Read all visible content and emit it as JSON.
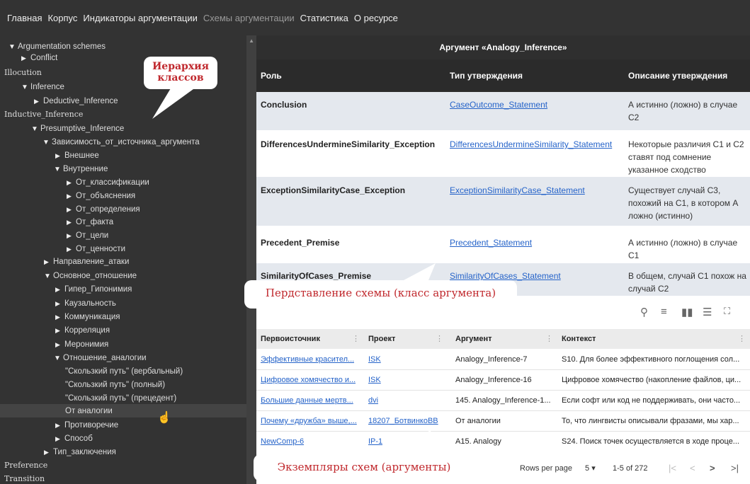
{
  "nav": {
    "items": [
      "Главная",
      "Корпус",
      "Индикаторы аргументации",
      "Схемы аргументации",
      "Статистика",
      "О ресурсе"
    ],
    "active": "Схемы аргументации"
  },
  "tree": {
    "root": "Argumentation schemes",
    "conflict": "Conflict",
    "illocution": "Illocution",
    "inference": "Inference",
    "deductive": "Deductive_Inference",
    "inductive": "Inductive_Inference",
    "presumptive": "Presumptive_Inference",
    "source_dep": "Зависимость_от_источника_аргумента",
    "external": "Внешнее",
    "internal": "Внутренние",
    "from_classification": "От_классификации",
    "from_explanation": "От_объяснения",
    "from_definition": "От_определения",
    "from_fact": "От_факта",
    "from_goal": "От_цели",
    "from_value": "От_ценности",
    "attack_direction": "Направление_атаки",
    "main_relation": "Основное_отношение",
    "hyper_hyponymy": "Гипер_Гипонимия",
    "causality": "Каузальность",
    "communication": "Коммуникация",
    "correlation": "Корреляция",
    "meronymy": "Меронимия",
    "analogy_relation": "Отношение_аналогии",
    "slippery_verbal": "\"Скользкий путь\" (вербальный)",
    "slippery_full": "\"Скользкий путь\" (полный)",
    "slippery_precedent": "\"Скользкий путь\" (прецедент)",
    "from_analogy": "От аналогии",
    "contradiction": "Противоречие",
    "method": "Способ",
    "conclusion_type": "Тип_заключения",
    "preference": "Preference",
    "transition": "Transition"
  },
  "callouts": {
    "hierarchy": "Иерархия классов",
    "scheme": "Пердставление схемы (класс аргумента)",
    "instances": "Экземпляры схем (аргументы)"
  },
  "argument": {
    "title": "Аргумент «Analogy_Inference»",
    "columns": [
      "Роль",
      "Тип утверждения",
      "Описание утверждения"
    ],
    "rows": [
      {
        "role": "Conclusion",
        "type": "CaseOutcome_Statement",
        "desc": "А истинно (ложно) в случае С2"
      },
      {
        "role": "DifferencesUndermineSimilarity_Exception",
        "type": "DifferencesUndermineSimilarity_Statement",
        "desc": "Некоторые различия С1 и С2 ставят под сомнение указанное сходство"
      },
      {
        "role": "ExceptionSimilarityCase_Exception",
        "type": "ExceptionSimilarityCase_Statement",
        "desc": "Существует случай С3, похожий на С1, в котором А ложно (истинно)"
      },
      {
        "role": "Precedent_Premise",
        "type": "Precedent_Statement",
        "desc": "А истинно (ложно) в случае С1"
      },
      {
        "role": "SimilarityOfCases_Premise",
        "type": "SimilarityOfCases_Statement",
        "desc": "В общем, случай С1 похож на случай С2"
      }
    ]
  },
  "instances": {
    "columns": [
      "Первоисточник",
      "Проект",
      "Аргумент",
      "Контекст"
    ],
    "rows": [
      {
        "source": "Эффективные красител...",
        "project": "ISK",
        "argument": "Analogy_Inference-7",
        "context": "S10. Для более эффективного поглощения сол..."
      },
      {
        "source": "Цифровое хомячество и...",
        "project": "ISK",
        "argument": "Analogy_Inference-16",
        "context": "Цифровое хомячество (накопление файлов, ци..."
      },
      {
        "source": "Большие данные мертв...",
        "project": "dvi",
        "argument": "145. Analogy_Inference-1...",
        "context": "Если софт или код не поддерживать, они часто..."
      },
      {
        "source": "Почему «дружба» выше,...",
        "project": "18207_БотвинкоВВ",
        "argument": "От аналогии",
        "context": "То, что лингвисты описывали фразами, мы хар..."
      },
      {
        "source": "NewComp-6",
        "project": "IP-1",
        "argument": "A15. Analogy",
        "context": "S24. Поиск точек осуществляется в ходе проце..."
      }
    ]
  },
  "pager": {
    "rows_per_page_label": "Rows per page",
    "rows_per_page": "5",
    "range": "1-5 of 272"
  },
  "icons": {
    "search": "search-icon",
    "filter": "filter-icon",
    "columns": "columns-icon",
    "density": "density-icon",
    "fullscreen": "fullscreen-icon"
  }
}
